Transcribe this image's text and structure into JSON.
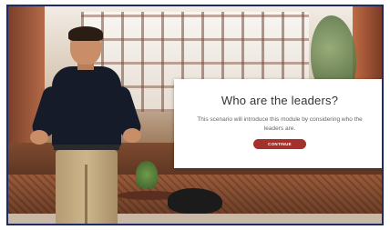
{
  "dialog": {
    "title": "Who are the leaders?",
    "body": "This scenario will introduce this module by considering who the leaders are.",
    "continue_label": "CONTINUE"
  },
  "colors": {
    "frame_border": "#1c2c63",
    "button_bg": "#a3322c",
    "dialog_bg": "#ffffff"
  }
}
